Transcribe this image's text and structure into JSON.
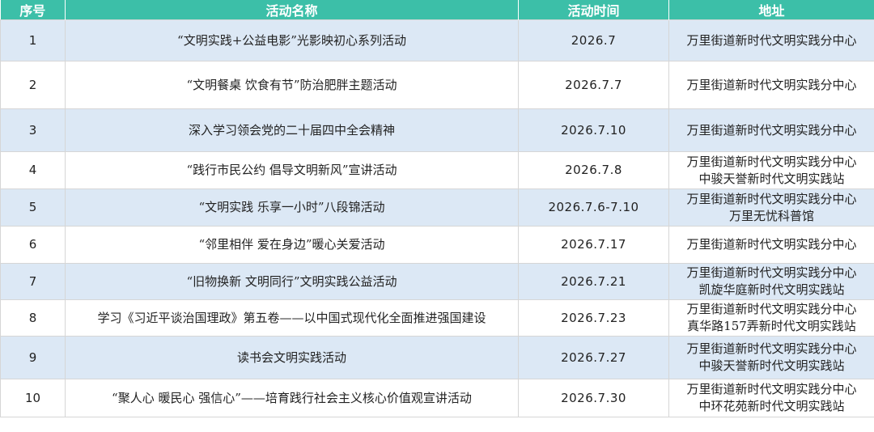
{
  "header": {
    "no": "序号",
    "name": "活动名称",
    "time": "活动时间",
    "address": "地址"
  },
  "rows": [
    {
      "no": "1",
      "name": "“文明实践+公益电影”光影映初心系列活动",
      "time": "2026.7",
      "address": [
        "万里街道新时代文明实践分中心"
      ]
    },
    {
      "no": "2",
      "name": "“文明餐桌 饮食有节”防治肥胖主题活动",
      "time": "2026.7.7",
      "address": [
        "万里街道新时代文明实践分中心"
      ]
    },
    {
      "no": "3",
      "name": "深入学习领会党的二十届四中全会精神",
      "time": "2026.7.10",
      "address": [
        "万里街道新时代文明实践分中心"
      ]
    },
    {
      "no": "4",
      "name": "“践行市民公约 倡导文明新风”宣讲活动",
      "time": "2026.7.8",
      "address": [
        "万里街道新时代文明实践分中心",
        "中骏天誉新时代文明实践站"
      ]
    },
    {
      "no": "5",
      "name": "“文明实践 乐享一小时”八段锦活动",
      "time": "2026.7.6-7.10",
      "address": [
        "万里街道新时代文明实践分中心",
        "万里无忧科普馆"
      ]
    },
    {
      "no": "6",
      "name": "“邻里相伴 爱在身边”暖心关爱活动",
      "time": "2026.7.17",
      "address": [
        "万里街道新时代文明实践分中心"
      ]
    },
    {
      "no": "7",
      "name": "“旧物换新 文明同行”文明实践公益活动",
      "time": "2026.7.21",
      "address": [
        "万里街道新时代文明实践分中心",
        "凯旋华庭新时代文明实践站"
      ]
    },
    {
      "no": "8",
      "name": "学习《习近平谈治国理政》第五卷——以中国式现代化全面推进强国建设",
      "time": "2026.7.23",
      "address": [
        "万里街道新时代文明实践分中心",
        "真华路157弄新时代文明实践站"
      ]
    },
    {
      "no": "9",
      "name": "读书会文明实践活动",
      "time": "2026.7.27",
      "address": [
        "万里街道新时代文明实践分中心",
        "中骏天誉新时代文明实践站"
      ]
    },
    {
      "no": "10",
      "name": "“聚人心 暖民心 强信心”——培育践行社会主义核心价值观宣讲活动",
      "time": "2026.7.30",
      "address": [
        "万里街道新时代文明实践分中心",
        "中环花苑新时代文明实践站"
      ]
    }
  ],
  "colors": {
    "header_bg": "#3cbfa8",
    "shaded_row": "#dce8f5",
    "plain_row": "#ffffff"
  }
}
